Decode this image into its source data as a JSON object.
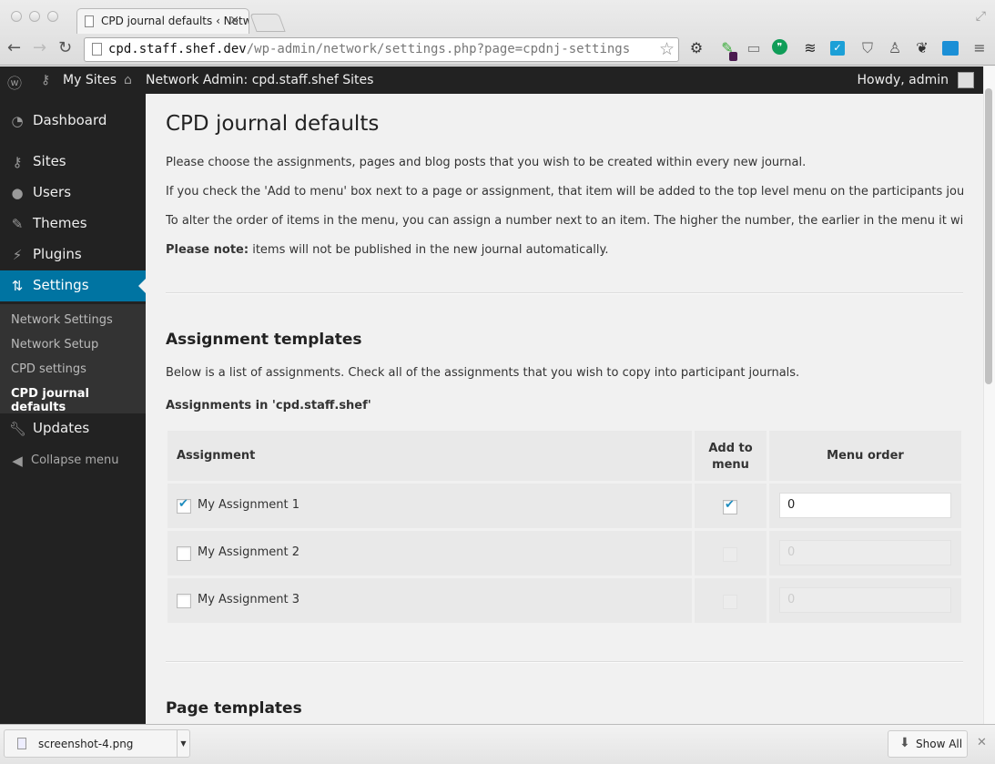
{
  "browser": {
    "tab_title": "CPD journal defaults ‹ Netw",
    "url_host": "cpd.staff.shef.dev",
    "url_path": "/wp-admin/network/settings.php?page=cpdnj-settings",
    "extensions": [
      "gear-icon",
      "eyedropper-icon",
      "cast-icon",
      "hangouts-icon",
      "buffer-icon",
      "checkbox-ext-icon",
      "pocket-icon",
      "lamp-icon",
      "evernote-icon",
      "screenshot-icon",
      "menu-icon"
    ]
  },
  "adminbar": {
    "my_sites": "My Sites",
    "network_admin": "Network Admin: cpd.staff.shef Sites",
    "howdy": "Howdy, admin"
  },
  "sidebar": {
    "items": [
      {
        "label": "Dashboard",
        "icon": "dashboard-icon"
      },
      {
        "label": "Sites",
        "icon": "key-icon"
      },
      {
        "label": "Users",
        "icon": "user-icon"
      },
      {
        "label": "Themes",
        "icon": "brush-icon"
      },
      {
        "label": "Plugins",
        "icon": "plug-icon"
      },
      {
        "label": "Settings",
        "icon": "settings-icon",
        "active": true
      }
    ],
    "submenu": [
      {
        "label": "Network Settings"
      },
      {
        "label": "Network Setup"
      },
      {
        "label": "CPD settings"
      },
      {
        "label": "CPD journal defaults",
        "current": true
      }
    ],
    "updates": "Updates",
    "collapse": "Collapse menu"
  },
  "page": {
    "title": "CPD journal defaults",
    "intro": [
      "Please choose the assignments, pages and blog posts that you wish to be created within every new journal.",
      "If you check the 'Add to menu' box next to a page or assignment, that item will be added to the top level menu on the participants journal.",
      "To alter the order of items in the menu, you can assign a number next to an item. The higher the number, the earlier in the menu it will appear."
    ],
    "note_label": "Please note:",
    "note_text": " items will not be published in the new journal automatically.",
    "assignments": {
      "heading": "Assignment templates",
      "description": "Below is a list of assignments. Check all of the assignments that you wish to copy into participant journals.",
      "subheading": "Assignments in 'cpd.staff.shef'",
      "columns": [
        "Assignment",
        "Add to",
        "menu",
        "Menu order"
      ],
      "rows": [
        {
          "name": "My Assignment 1",
          "checked": true,
          "add_to_menu": true,
          "menu_order": "0",
          "enabled": true
        },
        {
          "name": "My Assignment 2",
          "checked": false,
          "add_to_menu": false,
          "menu_order": "0",
          "enabled": false
        },
        {
          "name": "My Assignment 3",
          "checked": false,
          "add_to_menu": false,
          "menu_order": "0",
          "enabled": false
        }
      ]
    },
    "pages_heading": "Page templates"
  },
  "downloads": {
    "file": "screenshot-4.png",
    "show_all": "Show All"
  },
  "colors": {
    "accent": "#0074a2",
    "sidebar_bg": "#222222",
    "check": "#1e8cbe"
  }
}
